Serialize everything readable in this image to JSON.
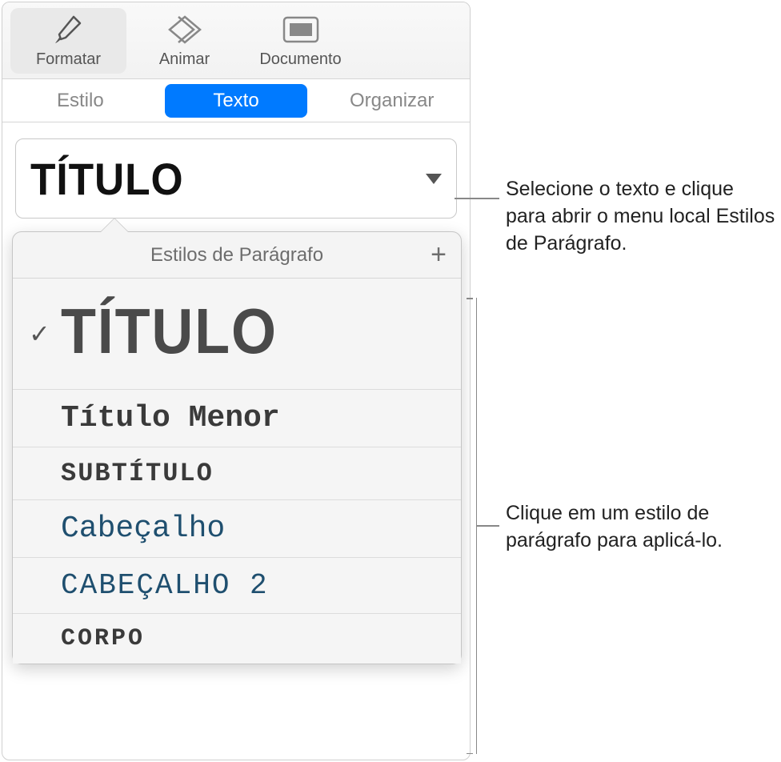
{
  "toolbar": {
    "format": "Formatar",
    "animate": "Animar",
    "document": "Documento"
  },
  "tabs": {
    "style": "Estilo",
    "text": "Texto",
    "arrange": "Organizar"
  },
  "current_style": "TÍTULO",
  "popover": {
    "title": "Estilos de Parágrafo",
    "styles": {
      "titulo": "TÍTULO",
      "titulo_menor": "Título Menor",
      "subtitulo": "SUBTÍTULO",
      "cabecalho": "Cabeçalho",
      "cabecalho2": "CABEÇALHO 2",
      "corpo": "CORPO"
    }
  },
  "callouts": {
    "c1": "Selecione o texto e clique para abrir o menu local Estilos de Parágrafo.",
    "c2": "Clique em um estilo de parágrafo para aplicá-lo."
  }
}
